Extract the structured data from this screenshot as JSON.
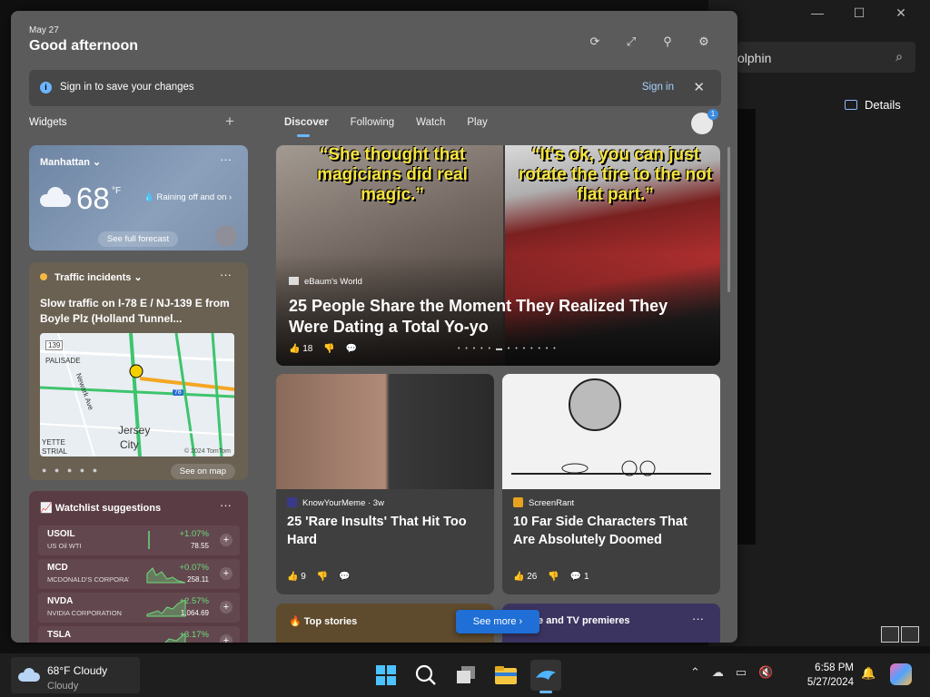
{
  "background_window": {
    "controls": [
      "—",
      "☐",
      "✕"
    ],
    "search_text": "olphin",
    "details_label": "Details"
  },
  "widgets": {
    "header": {
      "date": "May 27",
      "greeting": "Good afternoon"
    },
    "signin_bar": {
      "message": "Sign in to save your changes",
      "link": "Sign in"
    },
    "widgets_label": "Widgets",
    "tabs": [
      "Discover",
      "Following",
      "Watch",
      "Play"
    ],
    "weather": {
      "location": "Manhattan",
      "temp": "68",
      "unit": "°F",
      "condition": "Raining off and on",
      "forecast_btn": "See full forecast"
    },
    "traffic": {
      "title": "Traffic incidents",
      "headline": "Slow traffic on I-78 E / NJ-139 E from Boyle Plz (Holland Tunnel...",
      "map_labels": [
        "139",
        "PALISADE",
        "Newark Ave",
        "Jersey",
        "City",
        "78",
        "YETTE",
        "STRIAL"
      ],
      "map_copyright": "© 2024 TomTom",
      "see_map": "See on map"
    },
    "watchlist": {
      "title": "Watchlist suggestions",
      "stocks": [
        {
          "symbol": "USOIL",
          "name": "US Oil WTI",
          "change": "+1.07%",
          "price": "78.55"
        },
        {
          "symbol": "MCD",
          "name": "MCDONALD'S CORPORATI...",
          "change": "+0.07%",
          "price": "258.11"
        },
        {
          "symbol": "NVDA",
          "name": "NVIDIA CORPORATION",
          "change": "+2.57%",
          "price": "1,064.69"
        },
        {
          "symbol": "TSLA",
          "name": "",
          "change": "+3.17%",
          "price": ""
        }
      ]
    },
    "hero": {
      "caption_left": "“She thought that magicians did real magic.”",
      "caption_right": "“It's ok, you can just rotate the tire to the not flat part.”",
      "source": "eBaum's World",
      "title": "25 People Share the Moment They Realized They Were Dating a Total Yo-yo",
      "likes": "18"
    },
    "news": [
      {
        "source": "KnowYourMeme · 3w",
        "title": "25 'Rare Insults' That Hit Too Hard",
        "likes": "9",
        "comments": ""
      },
      {
        "source": "ScreenRant",
        "title": "10 Far Side Characters That Are Absolutely Doomed",
        "likes": "26",
        "comments": "1"
      }
    ],
    "bottom_cards": {
      "top_stories": "Top stories",
      "movie": "Movie and TV premieres"
    },
    "see_more": "See more"
  },
  "taskbar": {
    "weather_temp": "68°F Cloudy",
    "weather_sub": "Cloudy",
    "time": "6:58 PM",
    "date": "5/27/2024"
  },
  "colors": {
    "accent": "#1f6fd6",
    "positive": "#6ddc7b",
    "caption_yellow": "#f6e43c"
  }
}
